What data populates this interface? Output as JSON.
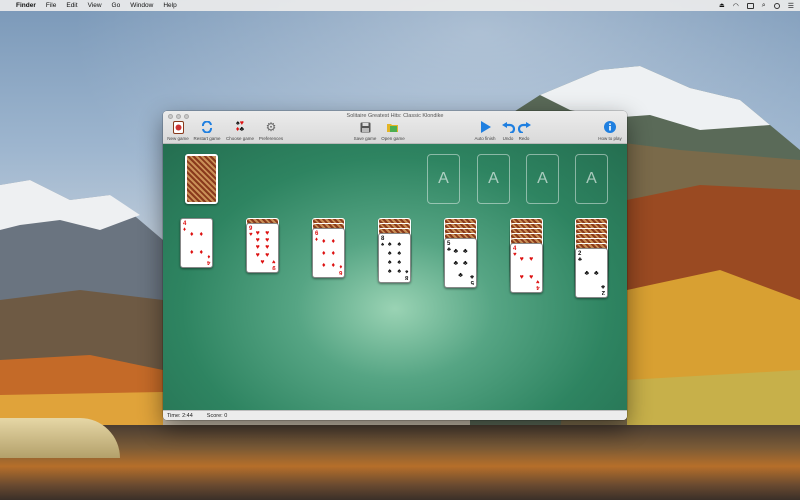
{
  "menubar": {
    "apple": "",
    "items": [
      "Finder",
      "File",
      "Edit",
      "View",
      "Go",
      "Window",
      "Help"
    ]
  },
  "window": {
    "title": "Solitaire Greatest Hits: Classic Klondike"
  },
  "toolbar": {
    "new_game": "New game",
    "restart_game": "Restart game",
    "choose_game": "Choose game",
    "preferences": "Preferences",
    "save_game": "Save game",
    "open_game": "Open game",
    "auto_finish": "Auto finish",
    "undo": "Undo",
    "redo": "Redo",
    "how_to_play": "How to play"
  },
  "foundations": [
    "A",
    "A",
    "A",
    "A"
  ],
  "tableau": [
    {
      "facedown": 0,
      "rank": "4",
      "suit": "♦",
      "color": "red"
    },
    {
      "facedown": 1,
      "rank": "9",
      "suit": "♥",
      "color": "red"
    },
    {
      "facedown": 2,
      "rank": "6",
      "suit": "♦",
      "color": "red"
    },
    {
      "facedown": 3,
      "rank": "8",
      "suit": "♠",
      "color": "black"
    },
    {
      "facedown": 4,
      "rank": "5",
      "suit": "♣",
      "color": "black"
    },
    {
      "facedown": 5,
      "rank": "4",
      "suit": "♥",
      "color": "red"
    },
    {
      "facedown": 6,
      "rank": "2",
      "suit": "♣",
      "color": "black"
    }
  ],
  "status": {
    "time": "Time: 2:44",
    "score": "Score: 0"
  },
  "colors": {
    "felt": "#2e8461",
    "card_back": "#8a3a1c",
    "accent_blue": "#1f7fe0"
  }
}
